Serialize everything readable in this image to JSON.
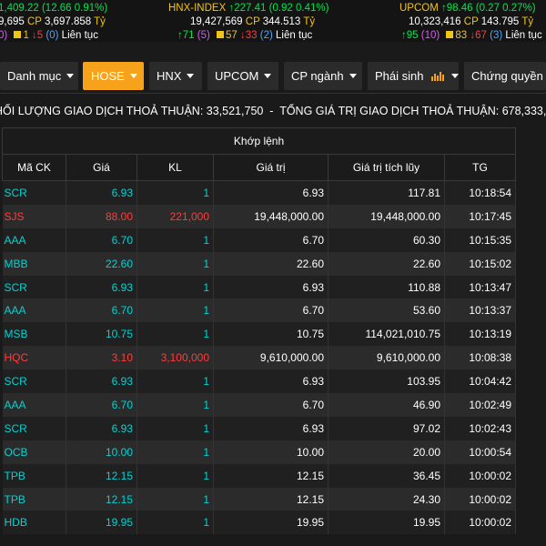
{
  "indices": [
    {
      "name": "",
      "value": "1,409.22",
      "change": "(12.66 0.91%)",
      "direction": "up",
      "volume": "9,695",
      "value_label": "CP",
      "value_amount": "3,697.858",
      "unit": "Tỷ",
      "up_count": "",
      "ceiling_count": "0)",
      "unchanged_count": "1",
      "down_count": "5",
      "floor_count": "(0)",
      "session": "Liên tục"
    },
    {
      "name": "HNX-INDEX",
      "value": "227.41",
      "change": "(0.92 0.41%)",
      "direction": "up",
      "volume": "19,427,569",
      "value_label": "CP",
      "value_amount": "344.513",
      "unit": "Tỷ",
      "up_count": "71",
      "ceiling_count": "(5)",
      "unchanged_count": "57",
      "down_count": "33",
      "floor_count": "(2)",
      "session": "Liên tục"
    },
    {
      "name": "UPCOM",
      "value": "98.46",
      "change": "(0.27 0.27%)",
      "direction": "up",
      "volume": "10,323,416",
      "value_label": "CP",
      "value_amount": "143.795",
      "unit": "Tỷ",
      "up_count": "95",
      "ceiling_count": "(10)",
      "unchanged_count": "83",
      "down_count": "67",
      "floor_count": "(3)",
      "session": "Liên tục"
    }
  ],
  "tabs": [
    {
      "label": "Danh mục",
      "dropdown": true,
      "active": false
    },
    {
      "label": "HOSE",
      "dropdown": true,
      "active": true
    },
    {
      "label": "HNX",
      "dropdown": true,
      "active": false
    },
    {
      "label": "UPCOM",
      "dropdown": true,
      "active": false
    },
    {
      "label": "CP ngành",
      "dropdown": true,
      "active": false
    },
    {
      "label": "Phái sinh",
      "dropdown": true,
      "active": false,
      "icon": "bar-chart-icon"
    },
    {
      "label": "Chứng quyền",
      "dropdown": false,
      "active": false
    }
  ],
  "summary": {
    "volume_label": "HỐI LƯỢNG GIAO DỊCH THOẢ THUẬN:",
    "volume_value": "33,521,750",
    "separator": "-",
    "value_label": "TỔNG GIÁ TRỊ GIAO DỊCH THOẢ THUẬN:",
    "value_value": "678,333,"
  },
  "table": {
    "group_header": "Khớp lệnh",
    "columns": [
      "Mã CK",
      "Giá",
      "KL",
      "Giá trị",
      "Giá trị tích lũy",
      "TG"
    ],
    "rows": [
      {
        "symbol": "SCR",
        "price": "6.93",
        "volume": "1",
        "value": "6.93",
        "cumulative": "117.81",
        "time": "10:18:54",
        "color": "cyan"
      },
      {
        "symbol": "SJS",
        "price": "88.00",
        "volume": "221,000",
        "value": "19,448,000.00",
        "cumulative": "19,448,000.00",
        "time": "10:17:45",
        "color": "red"
      },
      {
        "symbol": "AAA",
        "price": "6.70",
        "volume": "1",
        "value": "6.70",
        "cumulative": "60.30",
        "time": "10:15:35",
        "color": "cyan"
      },
      {
        "symbol": "MBB",
        "price": "22.60",
        "volume": "1",
        "value": "22.60",
        "cumulative": "22.60",
        "time": "10:15:02",
        "color": "cyan"
      },
      {
        "symbol": "SCR",
        "price": "6.93",
        "volume": "1",
        "value": "6.93",
        "cumulative": "110.88",
        "time": "10:13:47",
        "color": "cyan"
      },
      {
        "symbol": "AAA",
        "price": "6.70",
        "volume": "1",
        "value": "6.70",
        "cumulative": "53.60",
        "time": "10:13:37",
        "color": "cyan"
      },
      {
        "symbol": "MSB",
        "price": "10.75",
        "volume": "1",
        "value": "10.75",
        "cumulative": "114,021,010.75",
        "time": "10:13:19",
        "color": "cyan"
      },
      {
        "symbol": "HQC",
        "price": "3.10",
        "volume": "3,100,000",
        "value": "9,610,000.00",
        "cumulative": "9,610,000.00",
        "time": "10:08:38",
        "color": "red"
      },
      {
        "symbol": "SCR",
        "price": "6.93",
        "volume": "1",
        "value": "6.93",
        "cumulative": "103.95",
        "time": "10:04:42",
        "color": "cyan"
      },
      {
        "symbol": "AAA",
        "price": "6.70",
        "volume": "1",
        "value": "6.70",
        "cumulative": "46.90",
        "time": "10:02:49",
        "color": "cyan"
      },
      {
        "symbol": "SCR",
        "price": "6.93",
        "volume": "1",
        "value": "6.93",
        "cumulative": "97.02",
        "time": "10:02:43",
        "color": "cyan"
      },
      {
        "symbol": "OCB",
        "price": "10.00",
        "volume": "1",
        "value": "10.00",
        "cumulative": "20.00",
        "time": "10:00:54",
        "color": "cyan"
      },
      {
        "symbol": "TPB",
        "price": "12.15",
        "volume": "1",
        "value": "12.15",
        "cumulative": "36.45",
        "time": "10:00:02",
        "color": "cyan"
      },
      {
        "symbol": "TPB",
        "price": "12.15",
        "volume": "1",
        "value": "12.15",
        "cumulative": "24.30",
        "time": "10:00:02",
        "color": "cyan"
      },
      {
        "symbol": "HDB",
        "price": "19.95",
        "volume": "1",
        "value": "19.95",
        "cumulative": "19.95",
        "time": "10:00:02",
        "color": "cyan"
      }
    ]
  },
  "colors": {
    "accent": "#f7a21b",
    "up": "#00e64d",
    "reference": "#f0c419",
    "down": "#ff3b3b",
    "ceiling": "#d45cf0",
    "floor": "#4da6ff",
    "cyan": "#00d4d4"
  }
}
